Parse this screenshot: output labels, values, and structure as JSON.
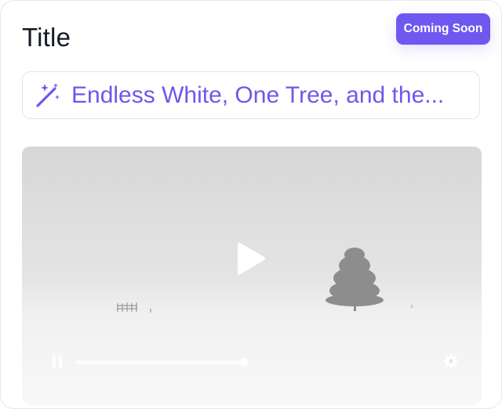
{
  "card": {
    "title": "Title",
    "status_badge": "Coming Soon",
    "title_value": "Endless White, One Tree, and the..."
  },
  "video": {
    "thumbnail": "snowy field with a single tree",
    "player_controls": [
      "play-icon",
      "pause-icon",
      "progress-bar",
      "settings-icon"
    ]
  },
  "icons": {
    "title_field": "magic-wand-icon",
    "center": "play-icon",
    "bottom_left": "pause-icon",
    "bottom_right": "gear-icon"
  },
  "colors": {
    "accent": "#6e58f0",
    "title_text": "#141a24",
    "border": "#e3e3ea"
  }
}
